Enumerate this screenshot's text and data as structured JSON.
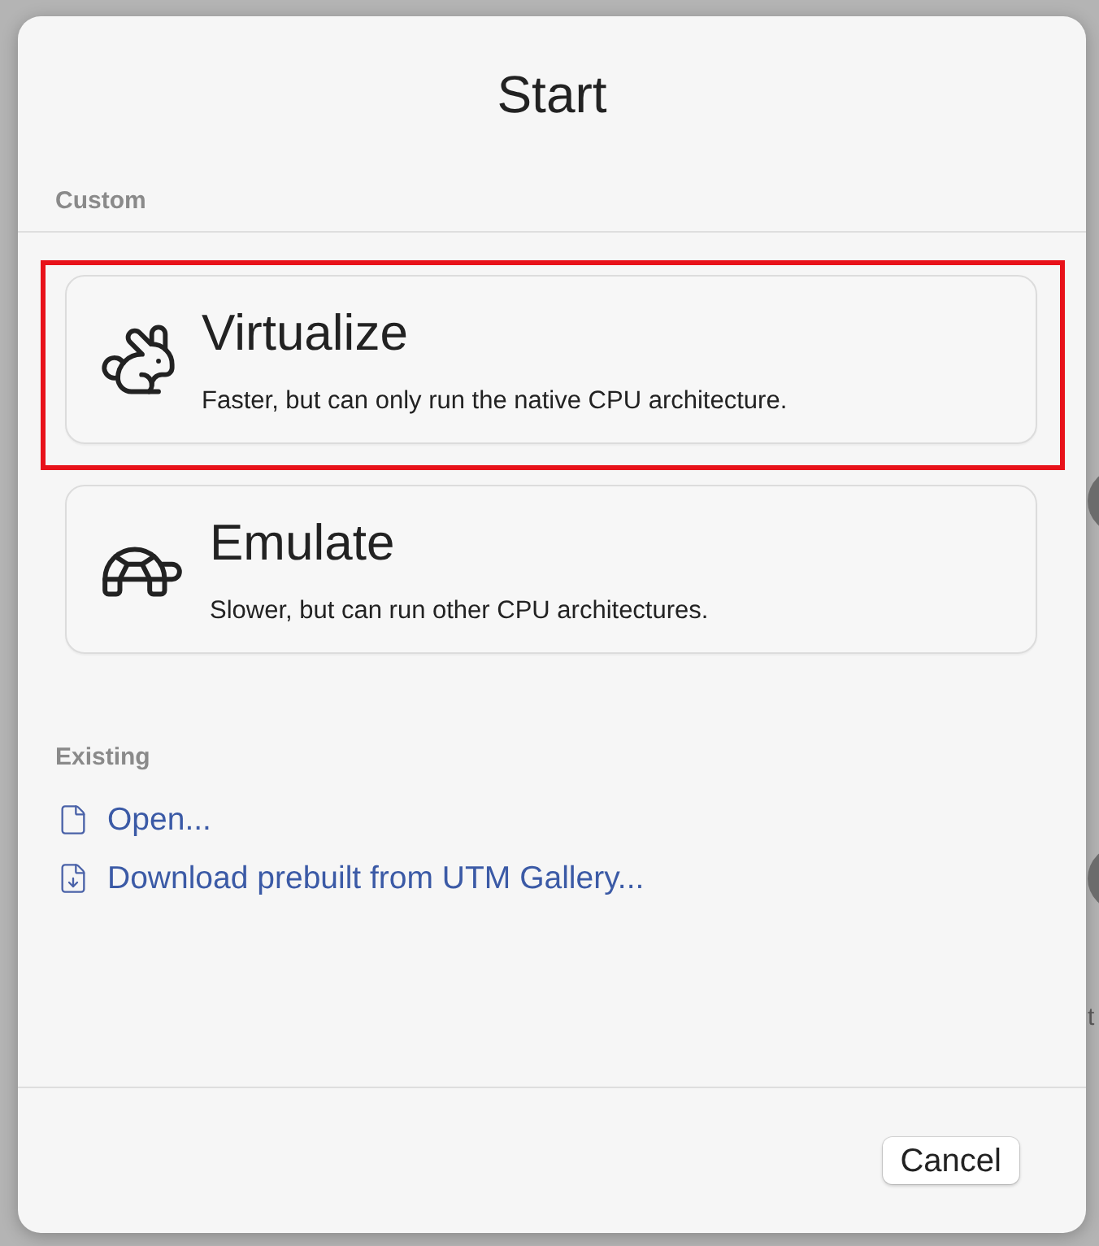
{
  "dialog": {
    "title": "Start",
    "custom": {
      "heading": "Custom",
      "options": [
        {
          "title": "Virtualize",
          "description": "Faster, but can only run the native CPU architecture.",
          "highlighted": true
        },
        {
          "title": "Emulate",
          "description": "Slower, but can run other CPU architectures.",
          "highlighted": false
        }
      ]
    },
    "existing": {
      "heading": "Existing",
      "links": [
        {
          "label": "Open..."
        },
        {
          "label": "Download prebuilt from UTM Gallery..."
        }
      ]
    },
    "buttons": [
      {
        "label": "Cancel"
      }
    ]
  },
  "background": {
    "text": "t"
  }
}
